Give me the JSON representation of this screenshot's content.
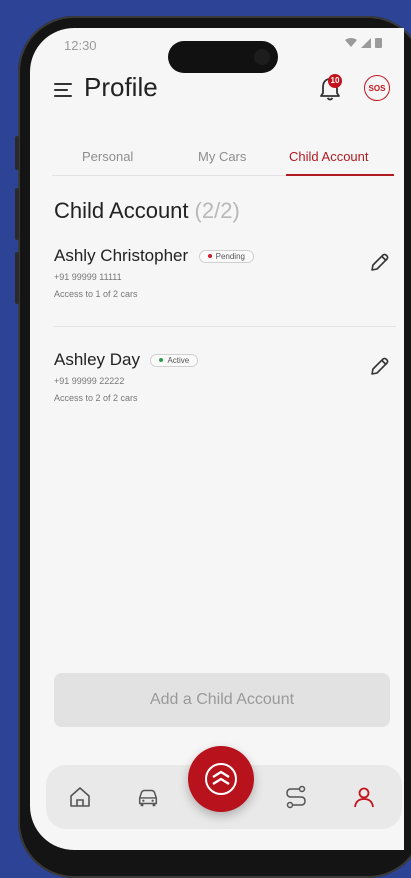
{
  "status_bar": {
    "time": "12:30"
  },
  "header": {
    "title": "Profile",
    "notification_count": "10",
    "sos_label": "SOS"
  },
  "tabs": [
    {
      "label": "Personal",
      "active": false
    },
    {
      "label": "My Cars",
      "active": false
    },
    {
      "label": "Child Account",
      "active": true
    }
  ],
  "section": {
    "title": "Child Account",
    "count": "(2/2)"
  },
  "children": [
    {
      "name": "Ashly Christopher",
      "status": "Pending",
      "status_color": "#d11a2a",
      "phone": "+91 99999 11111",
      "access": "Access to 1 of 2 cars"
    },
    {
      "name": "Ashley Day",
      "status": "Active",
      "status_color": "#2e9e44",
      "phone": "+91 99999 22222",
      "access": "Access to 2 of 2 cars"
    }
  ],
  "add_button": {
    "label": "Add a Child Account"
  },
  "nav": {
    "items": [
      "home-icon",
      "car-icon",
      "route-icon",
      "profile-icon"
    ],
    "active": "profile-icon",
    "center": "brand-chevron-icon"
  },
  "colors": {
    "accent": "#b01b22",
    "background": "#2d4396"
  }
}
